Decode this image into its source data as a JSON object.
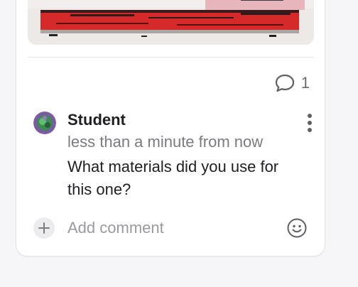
{
  "post": {
    "comment_count": "1"
  },
  "comment": {
    "author": "Student",
    "time": "less than a minute from now",
    "text": "What materials did you use for this one?"
  },
  "composer": {
    "placeholder": "Add comment"
  },
  "icons": {
    "comment": "speech-bubble-icon",
    "more": "vertical-ellipsis-icon",
    "add": "plus-icon",
    "emoji": "smiley-icon"
  },
  "colors": {
    "accent_red": "#d62a2a",
    "text": "#1f1f22",
    "muted": "#7b7b80"
  }
}
